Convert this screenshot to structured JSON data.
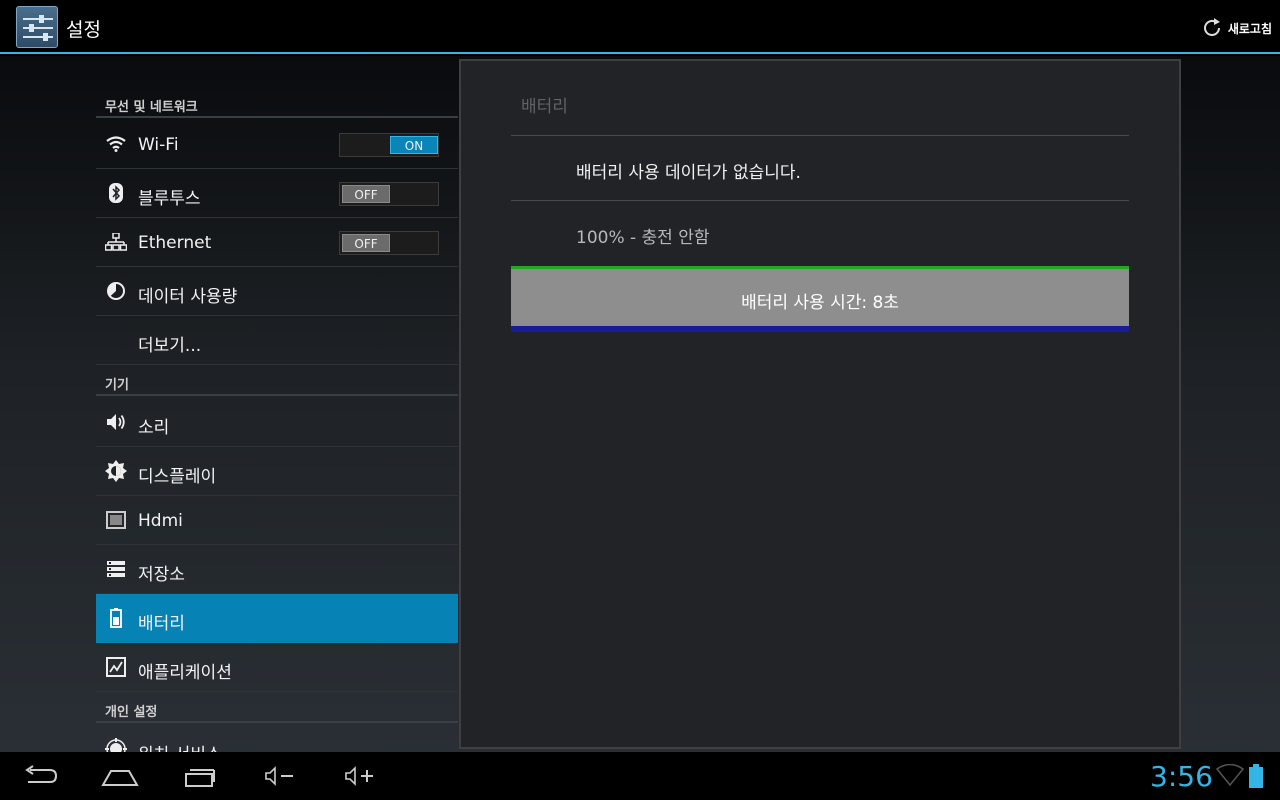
{
  "app": {
    "title": "설정",
    "refresh_label": "새로고침"
  },
  "colors": {
    "accent": "#33b5e5",
    "selected_bg": "#0782b5",
    "toggle_on": "#0b84b8"
  },
  "sidebar": {
    "sections": [
      {
        "header": "무선 및 네트워크"
      },
      {
        "header": "기기"
      },
      {
        "header": "개인 설정"
      }
    ],
    "items": [
      {
        "label": "Wi-Fi",
        "icon": "wifi-icon",
        "toggle": "ON",
        "toggle_state": "on"
      },
      {
        "label": "블루투스",
        "icon": "bluetooth-icon",
        "toggle": "OFF",
        "toggle_state": "off"
      },
      {
        "label": "Ethernet",
        "icon": "ethernet-icon",
        "toggle": "OFF",
        "toggle_state": "off"
      },
      {
        "label": "데이터 사용량",
        "icon": "data-usage-icon"
      },
      {
        "label": "더보기..."
      },
      {
        "label": "소리",
        "icon": "speaker-icon"
      },
      {
        "label": "디스플레이",
        "icon": "brightness-icon"
      },
      {
        "label": "Hdmi",
        "icon": "hdmi-icon"
      },
      {
        "label": "저장소",
        "icon": "storage-icon"
      },
      {
        "label": "배터리",
        "icon": "battery-icon",
        "selected": true
      },
      {
        "label": "애플리케이션",
        "icon": "apps-icon"
      },
      {
        "label": "위치 서비스",
        "icon": "location-icon"
      }
    ]
  },
  "detail": {
    "title": "배터리",
    "no_data": "배터리 사용 데이터가 없습니다.",
    "status": "100% - 충전 안함",
    "usage_time": "배터리 사용 시간: 8초"
  },
  "navbar": {
    "buttons": [
      "back-icon",
      "home-icon",
      "recent-apps-icon",
      "volume-down-icon",
      "volume-up-icon"
    ],
    "clock": "3:56"
  }
}
